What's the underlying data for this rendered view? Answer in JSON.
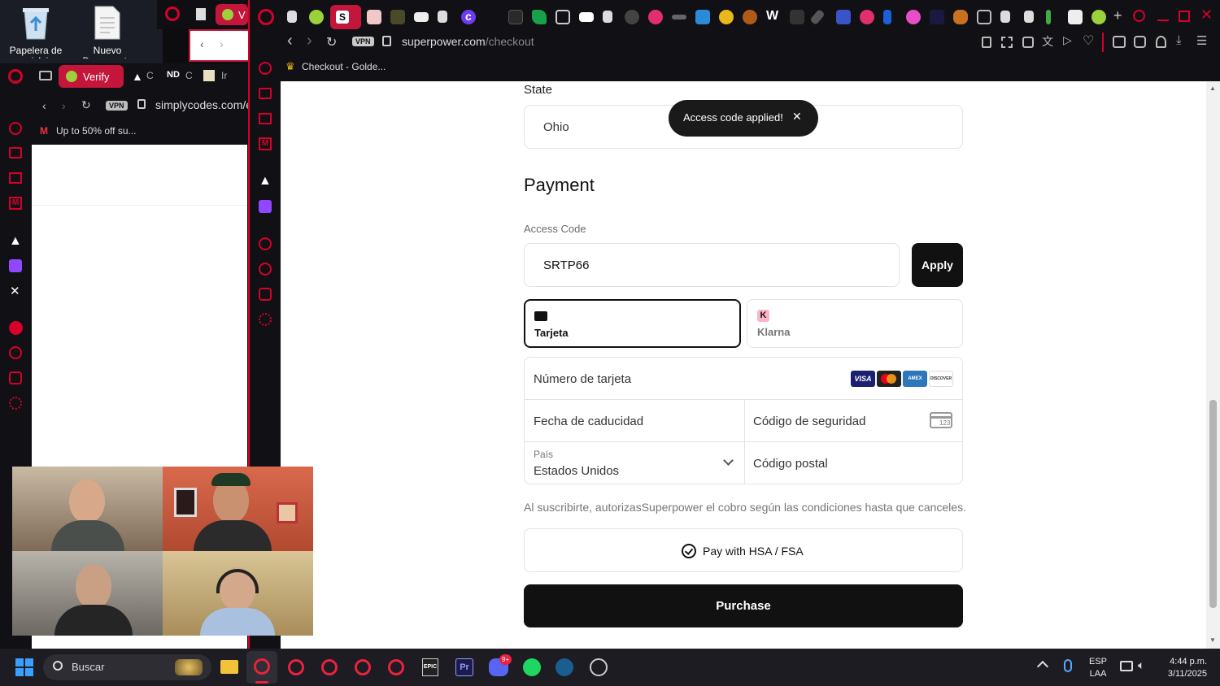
{
  "desktop": {
    "icons": [
      {
        "label": "Papelera de reciclaje"
      },
      {
        "label": "Nuevo Documento"
      }
    ]
  },
  "back_window": {
    "tab_label": "Verify",
    "url": "simplycodes.com/e",
    "vpn": "VPN",
    "bookmark": "Up to 50% off su...",
    "tabs_partial": [
      "C",
      "C",
      "Ir"
    ]
  },
  "browser": {
    "vpn": "VPN",
    "url_domain": "superpower.com",
    "url_path": "/checkout",
    "bookmark": "Checkout - Golde..."
  },
  "toast": {
    "text": "Access code applied!"
  },
  "form": {
    "state_label": "State",
    "state_value": "Ohio",
    "payment_title": "Payment",
    "access_code_label": "Access Code",
    "access_code_value": "SRTP66",
    "apply_label": "Apply",
    "methods": [
      {
        "label": "Tarjeta",
        "selected": true
      },
      {
        "label": "Klarna",
        "selected": false
      }
    ],
    "card_number_placeholder": "Número de tarjeta",
    "card_brands": [
      "VISA",
      "Mastercard",
      "AMEX",
      "DISCOVER"
    ],
    "expiry_placeholder": "Fecha de caducidad",
    "cvc_placeholder": "Código de seguridad",
    "cvc_hint": "123",
    "country_label": "País",
    "country_value": "Estados Unidos",
    "postal_placeholder": "Código postal",
    "disclaimer": "Al suscribirte, autorizasSuperpower el cobro según las condiciones hasta que canceles.",
    "hsa_label": "Pay with HSA / FSA",
    "purchase_label": "Purchase"
  },
  "taskbar": {
    "search_placeholder": "Buscar",
    "lang_1": "ESP",
    "lang_2": "LAA",
    "time": "4:44 p.m.",
    "date": "3/11/2025",
    "discord_badge": "9+"
  },
  "colors": {
    "accent": "#d6002a",
    "button_dark": "#111111",
    "toast_bg": "#1a1a1a"
  }
}
